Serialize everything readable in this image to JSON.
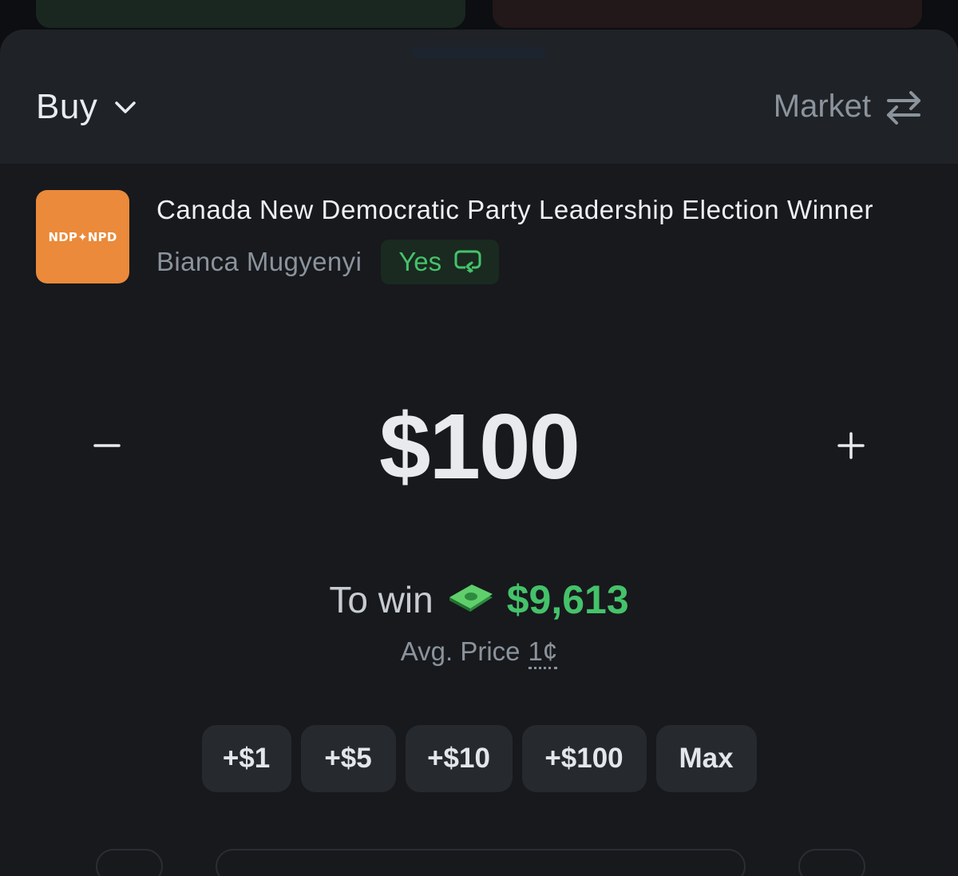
{
  "header": {
    "mode_label": "Buy",
    "order_type_label": "Market"
  },
  "market": {
    "logo_text": "NDP✦NPD",
    "title": "Canada New Democratic Party Leadership Election Winner",
    "outcome_name": "Bianca Mugyenyi",
    "side_label": "Yes"
  },
  "amount": {
    "minus_symbol": "−",
    "value": "$100",
    "plus_symbol": "+"
  },
  "payout": {
    "label": "To win",
    "value": "$9,613",
    "avg_price_label": "Avg. Price",
    "avg_price_value": "1¢"
  },
  "quick_add": {
    "buttons": [
      "+$1",
      "+$5",
      "+$10",
      "+$100",
      "Max"
    ]
  },
  "colors": {
    "accent_green": "#45c26a",
    "logo_orange": "#ea8a3a",
    "sheet_bg": "#17191d",
    "header_bg": "#1f2226"
  },
  "icons": {
    "mode_dropdown": "chevron-down-icon",
    "order_type_switch": "swap-arrows-icon",
    "side_switch": "switch-icon",
    "payout": "money-icon"
  }
}
